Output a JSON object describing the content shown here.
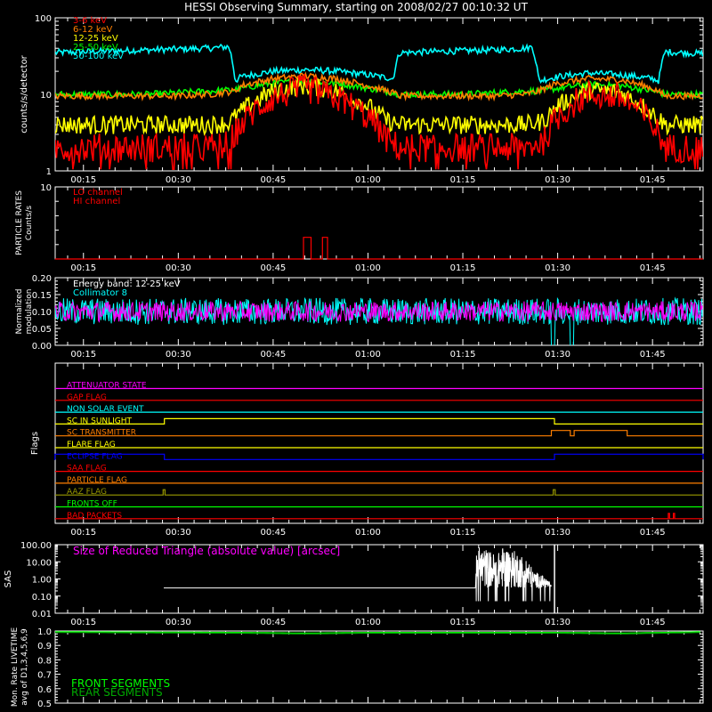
{
  "title": "HESSI Observing Summary, starting on 2008/02/27 00:10:32 UT",
  "colors": {
    "background": "#000000",
    "axes": "#ffffff",
    "red": "#ff0000",
    "orange": "#ff7f00",
    "yellow": "#ffff00",
    "green": "#00ff00",
    "cyan": "#00ffff",
    "magenta": "#ff00ff",
    "blue": "#0000ff",
    "olive": "#999900",
    "white": "#ffffff",
    "darkgreen": "#00aa00"
  },
  "chart_data": [
    {
      "id": "rates",
      "type": "line",
      "ylabel": "counts/s/detector",
      "yscale": "log",
      "ylim": [
        1,
        100
      ],
      "yticks": [
        "1",
        "10",
        "100"
      ],
      "xlim_minutes": [
        10.53,
        113.0
      ],
      "xtick_labels": [
        "00:15",
        "00:30",
        "00:45",
        "01:00",
        "01:15",
        "01:30",
        "01:45"
      ],
      "legend": [
        {
          "label": "3-6 keV",
          "color": "#ff0000"
        },
        {
          "label": "6-12 keV",
          "color": "#ff7f00"
        },
        {
          "label": "12-25 keV",
          "color": "#ffff00"
        },
        {
          "label": "25-50 keV",
          "color": "#00ff00"
        },
        {
          "label": "50-100 keV",
          "color": "#00ffff"
        }
      ],
      "series": [
        {
          "name": "50-100 keV",
          "color": "#00ffff",
          "x": [
            10.5,
            15,
            20,
            25,
            30,
            35,
            38,
            39,
            40,
            45,
            50,
            55,
            60,
            64,
            65,
            70,
            75,
            80,
            85,
            86,
            87,
            90,
            95,
            100,
            105,
            106,
            107,
            113
          ],
          "y": [
            35,
            36,
            37,
            38,
            39,
            40,
            42,
            15,
            17,
            20,
            21,
            20,
            18,
            16,
            35,
            36,
            37,
            38,
            40,
            42,
            15,
            17,
            19,
            18,
            16,
            15,
            36,
            34
          ]
        },
        {
          "name": "25-50 keV",
          "color": "#00ff00",
          "x": [
            10.5,
            15,
            20,
            25,
            30,
            35,
            39,
            40,
            45,
            50,
            55,
            60,
            64,
            65,
            70,
            75,
            80,
            85,
            87,
            90,
            95,
            100,
            105,
            107,
            113
          ],
          "y": [
            10,
            10,
            10,
            10,
            10.5,
            11,
            11.5,
            12,
            14,
            15,
            14,
            12,
            10.5,
            10,
            10,
            10,
            10.5,
            11,
            11,
            12,
            13.5,
            13,
            11,
            10,
            10
          ]
        },
        {
          "name": "6-12 keV",
          "color": "#ff7f00",
          "x": [
            10.5,
            15,
            20,
            25,
            30,
            35,
            39,
            40,
            45,
            50,
            55,
            60,
            64,
            65,
            70,
            75,
            80,
            85,
            87,
            90,
            95,
            100,
            105,
            107,
            113
          ],
          "y": [
            9.5,
            9.5,
            9.5,
            9.5,
            9.5,
            10,
            11,
            13,
            16,
            17.5,
            16,
            13,
            10.5,
            9.5,
            9.5,
            9.5,
            9.5,
            10,
            11,
            14,
            16,
            15.5,
            12,
            9.5,
            9.5
          ]
        },
        {
          "name": "12-25 keV",
          "color": "#ffff00",
          "x": [
            10.5,
            15,
            20,
            25,
            30,
            35,
            38,
            40,
            45,
            50,
            55,
            60,
            63,
            65,
            70,
            75,
            80,
            85,
            88,
            90,
            95,
            100,
            104,
            107,
            113
          ],
          "y": [
            4,
            4,
            4,
            4,
            4,
            4,
            4.2,
            6,
            11,
            13,
            11,
            7,
            4.5,
            4,
            4,
            4,
            4,
            4,
            4.5,
            7,
            11.5,
            10.5,
            6.5,
            4,
            4
          ]
        },
        {
          "name": "3-6 keV",
          "color": "#ff0000",
          "x": [
            10.5,
            15,
            20,
            25,
            30,
            35,
            38,
            40,
            45,
            50,
            55,
            60,
            63,
            65,
            70,
            75,
            80,
            85,
            88,
            90,
            95,
            100,
            104,
            107,
            113
          ],
          "y": [
            2,
            2,
            2,
            2,
            2,
            2,
            2.2,
            4,
            9,
            12,
            9,
            5,
            2.5,
            2,
            2,
            2,
            2,
            2,
            2.5,
            5,
            10,
            9,
            5,
            2,
            2
          ]
        }
      ]
    },
    {
      "id": "particle",
      "type": "line",
      "ylabel_lines": [
        "PARTICLE RATES",
        "Counts/s"
      ],
      "ylim": [
        0,
        10
      ],
      "yticks": [
        "10"
      ],
      "xtick_labels": [
        "00:15",
        "00:30",
        "00:45",
        "01:00",
        "01:15",
        "01:30",
        "01:45"
      ],
      "legend": [
        {
          "label": "LO channel",
          "color": "#ff0000"
        },
        {
          "label": "HI channel",
          "color": "#ff0000"
        }
      ],
      "series": [
        {
          "name": "LO channel",
          "color": "#ff0000",
          "x": [
            10.5,
            49.8,
            49.8,
            51.0,
            51.0,
            52.8,
            52.8,
            53.6,
            53.6,
            113
          ],
          "y": [
            0,
            0,
            3,
            3,
            0,
            0,
            3,
            3,
            0,
            0
          ]
        }
      ]
    },
    {
      "id": "modulation",
      "type": "line",
      "ylabel_lines": [
        "Normalized",
        "modulation"
      ],
      "ylim": [
        0,
        0.2
      ],
      "yticks": [
        "0.00",
        "0.05",
        "0.10",
        "0.15",
        "0.20"
      ],
      "xtick_labels": [
        "00:15",
        "00:30",
        "00:45",
        "01:00",
        "01:15",
        "01:30",
        "01:45"
      ],
      "annotation": "Energy band: 12-25 keV",
      "legend": [
        {
          "label": "Collimator 8",
          "color": "#00ffff"
        }
      ],
      "series": [
        {
          "name": "Collimator 8",
          "color": "#00ffff",
          "mean": 0.1,
          "spread": 0.04,
          "dropouts_minutes": [
            [
              89.0,
              89.6
            ],
            [
              92.0,
              92.6
            ]
          ]
        },
        {
          "color": "#ff00ff",
          "mean": 0.1,
          "spread": 0.03
        }
      ]
    },
    {
      "id": "flags",
      "type": "line",
      "ylabel": "Flags",
      "xtick_labels": [
        "00:15",
        "00:30",
        "00:45",
        "01:00",
        "01:15",
        "01:30",
        "01:45"
      ],
      "flags": [
        {
          "label": "ATTENUATOR STATE",
          "color": "#ff00ff",
          "high": []
        },
        {
          "label": "GAP FLAG",
          "color": "#ff0000",
          "high": []
        },
        {
          "label": "NON SOLAR EVENT",
          "color": "#00ffff",
          "high": []
        },
        {
          "label": "SC IN SUNLIGHT",
          "color": "#ffff00",
          "high": [
            [
              27.8,
              89.5
            ]
          ]
        },
        {
          "label": "SC TRANSMITTER",
          "color": "#ff7f00",
          "high": [
            [
              89.0,
              92.0
            ],
            [
              92.6,
              101.0
            ]
          ]
        },
        {
          "label": "FLARE FLAG",
          "color": "#ffff00",
          "high": []
        },
        {
          "label": "ECLIPSE FLAG",
          "color": "#0000ff",
          "high": [
            [
              10.5,
              27.8
            ],
            [
              89.5,
              113.0
            ]
          ]
        },
        {
          "label": "SAA FLAG",
          "color": "#ff0000",
          "high": []
        },
        {
          "label": "PARTICLE FLAG",
          "color": "#ff7f00",
          "high": []
        },
        {
          "label": "AAZ FLAG",
          "color": "#999900",
          "high": [
            [
              27.6,
              27.9
            ],
            [
              89.3,
              89.6
            ]
          ]
        },
        {
          "label": "FRONTS OFF",
          "color": "#00ff00",
          "high": []
        },
        {
          "label": "BAD PACKETS",
          "color": "#ff0000",
          "high": [
            [
              107.5,
              107.7
            ],
            [
              108.3,
              108.5
            ]
          ]
        }
      ]
    },
    {
      "id": "sas",
      "type": "line",
      "ylabel": "SAS",
      "yscale": "log",
      "ylim": [
        0.01,
        100
      ],
      "yticks": [
        "0.01",
        "0.10",
        "1.00",
        "10.00",
        "100.00"
      ],
      "xtick_labels": [
        "00:15",
        "00:30",
        "00:45",
        "01:00",
        "01:15",
        "01:30",
        "01:45"
      ],
      "annotation": "Size of Reduced Triangle (absolute value) [arcsec]",
      "series": [
        {
          "color": "#ffffff",
          "x": [
            27.7,
            77.0,
            77.5,
            80.0,
            81.0,
            84.0,
            86.0,
            89.0,
            89.5,
            90.0
          ],
          "y": [
            0.3,
            0.3,
            80,
            30,
            80,
            30,
            10,
            0.4,
            100,
            0.01
          ]
        }
      ]
    },
    {
      "id": "livetime",
      "type": "line",
      "ylabel_lines": [
        "Mon. Rate LIVETIME",
        "avg of D1,3,4,5,6,9"
      ],
      "ylim": [
        0.5,
        1.0
      ],
      "yticks": [
        "0.5",
        "0.6",
        "0.7",
        "0.8",
        "0.9",
        "1.0"
      ],
      "legend": [
        {
          "label": "FRONT SEGMENTS",
          "color": "#00ff00"
        },
        {
          "label": "REAR SEGMENTS",
          "color": "#00aa00"
        }
      ],
      "series": [
        {
          "name": "FRONT SEGMENTS",
          "color": "#00ff00",
          "x": [
            10.5,
            40,
            50,
            60,
            90,
            100,
            113
          ],
          "y": [
            0.995,
            0.99,
            0.985,
            0.99,
            0.99,
            0.985,
            0.995
          ]
        },
        {
          "name": "REAR SEGMENTS",
          "color": "#00aa00",
          "x": [
            10.5,
            40,
            50,
            60,
            90,
            100,
            113
          ],
          "y": [
            0.99,
            0.985,
            0.98,
            0.985,
            0.985,
            0.98,
            0.99
          ]
        }
      ]
    }
  ]
}
